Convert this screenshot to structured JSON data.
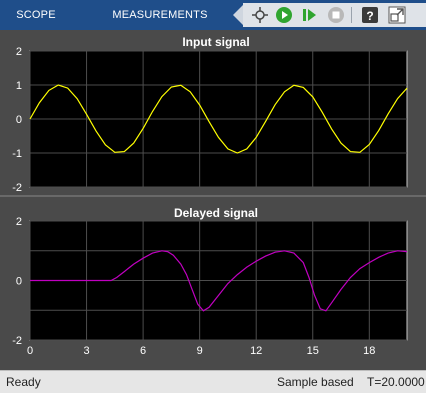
{
  "toolbar": {
    "tabs": [
      "SCOPE",
      "MEASUREMENTS"
    ],
    "buttons": [
      {
        "name": "highlight-simulink-block-icon"
      },
      {
        "name": "run-icon"
      },
      {
        "name": "step-forward-icon"
      },
      {
        "name": "stop-icon"
      },
      {
        "name": "help-icon"
      },
      {
        "name": "undock-icon"
      }
    ]
  },
  "plots": {
    "top_title": "Input signal",
    "bottom_title": "Delayed signal"
  },
  "chart_data": [
    {
      "type": "line",
      "title": "Input signal",
      "xlim": [
        0,
        20
      ],
      "ylim": [
        -2,
        2
      ],
      "yticks": [
        -2,
        -1,
        0,
        1,
        2
      ],
      "xticks": [
        0,
        3,
        6,
        9,
        12,
        15,
        18
      ],
      "grid": true,
      "series": [
        {
          "color": "#ffff00",
          "x": [
            0,
            0.5,
            1,
            1.5,
            2,
            2.5,
            3,
            3.5,
            4,
            4.5,
            5,
            5.5,
            6,
            6.5,
            7,
            7.5,
            8,
            8.5,
            9,
            9.5,
            10,
            10.5,
            11,
            11.5,
            12,
            12.5,
            13,
            13.5,
            14,
            14.5,
            15,
            15.5,
            16,
            16.5,
            17,
            17.5,
            18,
            18.5,
            19,
            19.5,
            20
          ],
          "y": [
            0,
            0.48,
            0.84,
            1.0,
            0.91,
            0.6,
            0.14,
            -0.35,
            -0.76,
            -0.98,
            -0.96,
            -0.71,
            -0.28,
            0.22,
            0.66,
            0.94,
            0.99,
            0.8,
            0.41,
            -0.08,
            -0.54,
            -0.88,
            -1.0,
            -0.88,
            -0.54,
            -0.07,
            0.42,
            0.8,
            0.99,
            0.93,
            0.65,
            0.2,
            -0.29,
            -0.71,
            -0.96,
            -0.98,
            -0.75,
            -0.34,
            0.15,
            0.6,
            0.91
          ]
        }
      ]
    },
    {
      "type": "line",
      "title": "Delayed signal",
      "xlim": [
        0,
        20
      ],
      "ylim": [
        -2,
        2
      ],
      "yticks": [
        -2,
        0,
        2
      ],
      "xticks": [
        0,
        3,
        6,
        9,
        12,
        15,
        18
      ],
      "grid": true,
      "series": [
        {
          "color": "#c000c0",
          "x": [
            0,
            4.3,
            4.6,
            5,
            5.5,
            6,
            6.5,
            7,
            7.3,
            7.6,
            8,
            8.3,
            8.6,
            8.9,
            9.2,
            9.5,
            10,
            10.5,
            11,
            11.5,
            12,
            12.5,
            13,
            13.5,
            14,
            14.5,
            14.8,
            15.1,
            15.4,
            15.7,
            16,
            16.5,
            17,
            17.5,
            18,
            18.5,
            19,
            19.5,
            20
          ],
          "y": [
            0,
            0,
            0.1,
            0.3,
            0.55,
            0.75,
            0.92,
            1.0,
            0.97,
            0.85,
            0.55,
            0.2,
            -0.3,
            -0.8,
            -1.02,
            -0.9,
            -0.5,
            -0.1,
            0.2,
            0.45,
            0.65,
            0.82,
            0.95,
            1.0,
            0.92,
            0.6,
            0.1,
            -0.5,
            -0.95,
            -1.02,
            -0.75,
            -0.3,
            0.1,
            0.4,
            0.6,
            0.78,
            0.92,
            1.0,
            0.97
          ]
        }
      ]
    }
  ],
  "status": {
    "left": "Ready",
    "mode": "Sample based",
    "time": "T=20.0000"
  }
}
